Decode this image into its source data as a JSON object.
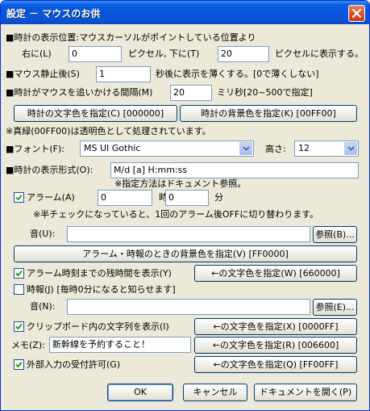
{
  "window": {
    "title": "設定 － マウスのお供"
  },
  "position": {
    "label": "■時計の表示位置:マウスカーソルがポイントしている位置より",
    "right_label": "右に(L)",
    "right_value": "0",
    "unit_down": "ピクセル, 下に(T)",
    "down_value": "20",
    "unit_suffix": "ピクセルに表示する。"
  },
  "stop": {
    "label": "■マウス静止後(S)",
    "value": "1",
    "suffix": "秒後に表示を薄くする。[0で薄くしない]"
  },
  "interval": {
    "label": "■時計がマウスを追いかける間隔(M)",
    "value": "20",
    "suffix": "ミリ秒[20~500で指定]"
  },
  "clock_colors": {
    "text_button": "時計の文字色を指定(C) [000000]",
    "bg_button": "時計の背景色を指定(K) [00FF00]",
    "note": "※真緑(00FF00)は透明色として処理されています。"
  },
  "font": {
    "label": "■フォント(F):",
    "value": "MS UI Gothic",
    "height_label": "高さ:",
    "height_value": "12"
  },
  "format": {
    "label": "■時計の表示形式(O):",
    "value": "M/d [a] H:mm:ss",
    "note": "※指定方法はドキュメント参照。"
  },
  "alarm": {
    "checkbox_label": "アラーム(A)",
    "checked": true,
    "hour_value": "0",
    "hour_label": "時",
    "minute_value": "0",
    "minute_label": "分",
    "note": "※半チェックになっていると、1回のアラーム後OFFに切り替わります。",
    "sound_label": "音(U):",
    "sound_value": "",
    "browse_button": "参照(B)...",
    "bg_button": "アラーム・時報のときの背景色を指定(V) [FF0000]"
  },
  "remaining": {
    "checkbox_label": "アラーム時刻までの残時間を表示(Y)",
    "checked": true,
    "color_button": "←の文字色を指定(W) [660000]"
  },
  "chime": {
    "checkbox_label": "時報(J) [毎時0分になると知らせます]",
    "checked": false,
    "sound_label": "音(N):",
    "sound_value": "",
    "browse_button": "参照(E)..."
  },
  "clipboard": {
    "checkbox_label": "クリップボード内の文字列を表示(I)",
    "checked": true,
    "color_button": "←の文字色を指定(X) [0000FF]"
  },
  "memo": {
    "label": "メモ(Z):",
    "value": "新幹線を予約すること！",
    "color_button": "←の文字色を指定(R) [006600]"
  },
  "external": {
    "checkbox_label": "外部入力の受付許可(G)",
    "checked": true,
    "color_button": "←の文字色を指定(Q) [FF00FF]"
  },
  "footer": {
    "ok": "OK",
    "cancel": "キャンセル",
    "doc": "ドキュメントを開く(P)"
  }
}
